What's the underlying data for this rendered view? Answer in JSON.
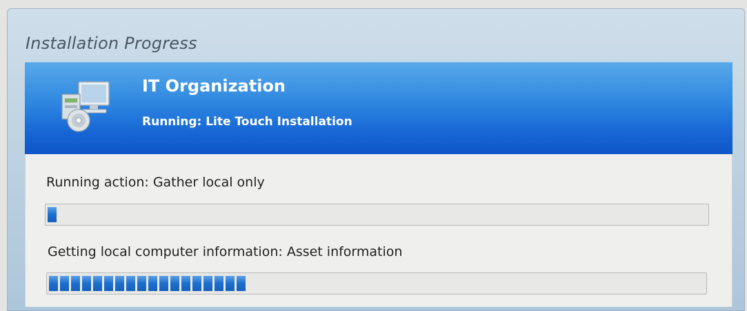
{
  "window": {
    "title": "Installation Progress"
  },
  "header": {
    "organization": "IT Organization",
    "status": "Running: Lite Touch Installation",
    "icon": "install-computer-icon"
  },
  "progress": {
    "action_label": "Running action: Gather local only",
    "action_progress": 0.01,
    "task_label": "Getting local computer information: Asset information",
    "task_progress": 0.31
  },
  "colors": {
    "header_blue": "#1867d6",
    "progress_blue": "#1d6fcc"
  }
}
